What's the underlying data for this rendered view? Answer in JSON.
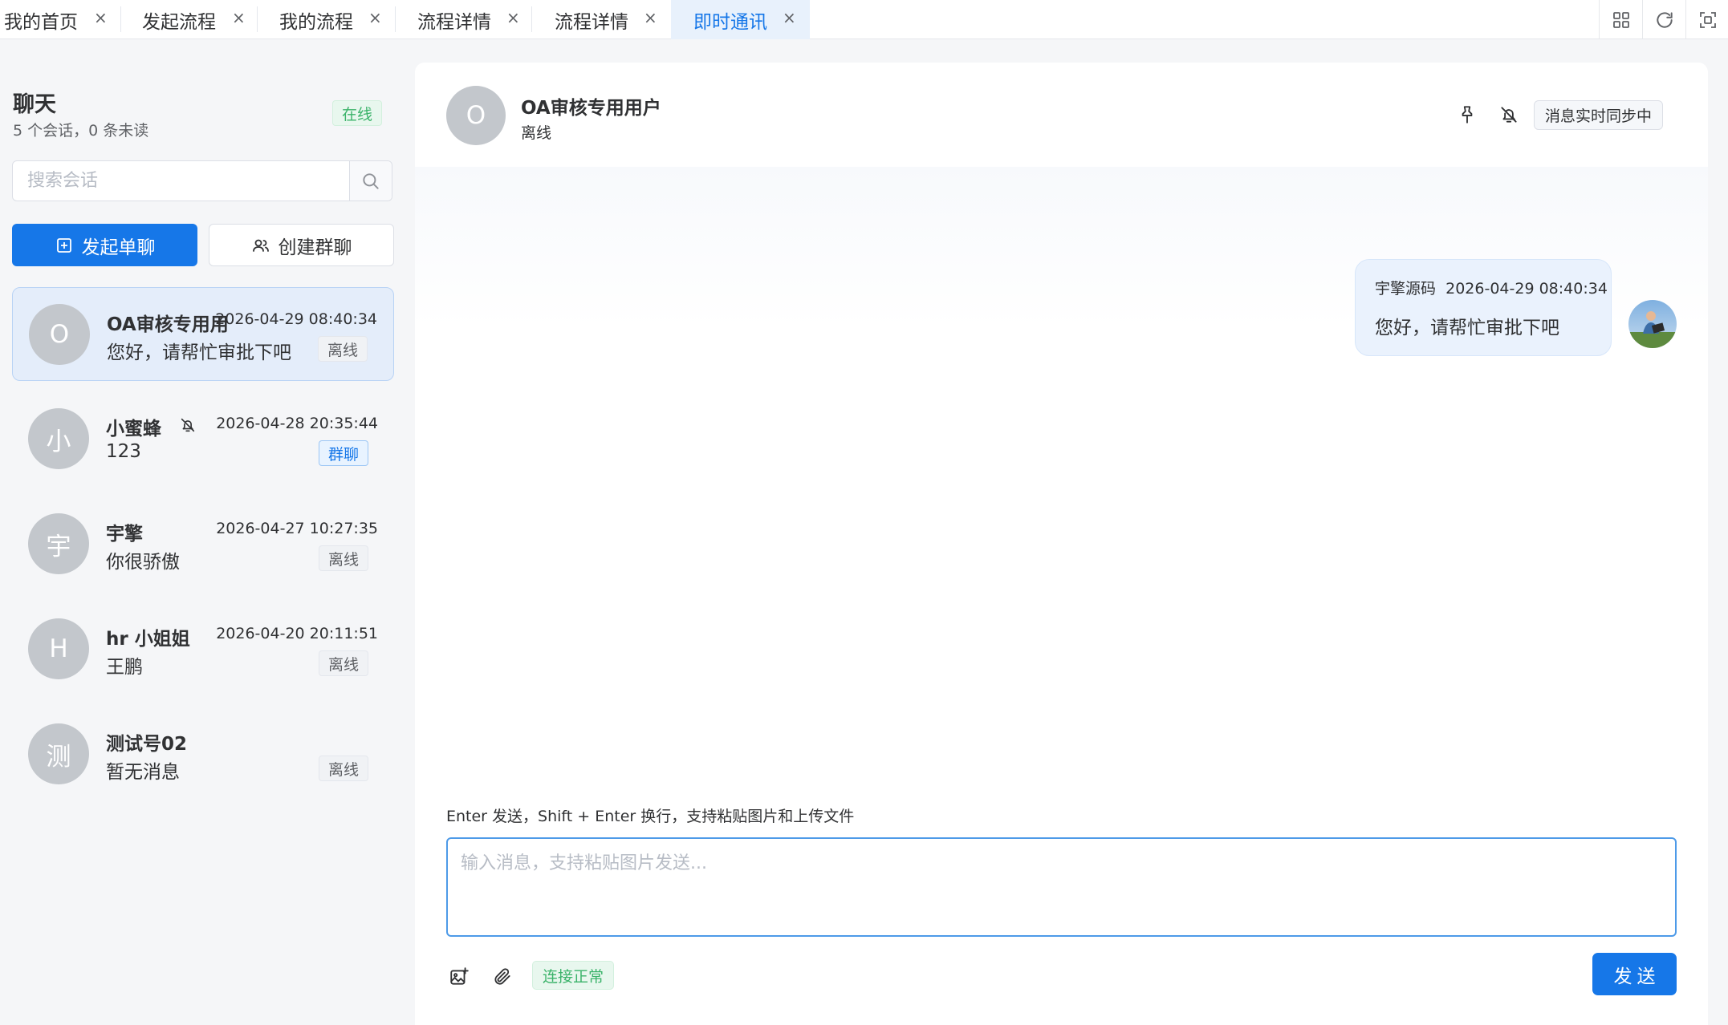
{
  "tabs": [
    {
      "label": "我的首页",
      "close": "×"
    },
    {
      "label": "发起流程",
      "close": "×"
    },
    {
      "label": "我的流程",
      "close": "×"
    },
    {
      "label": "流程详情",
      "close": "×"
    },
    {
      "label": "流程详情",
      "close": "×"
    },
    {
      "label": "即时通讯",
      "close": "×",
      "active": true
    }
  ],
  "toolbar": {
    "icons": [
      "grid-icon",
      "refresh-icon",
      "fullscreen-icon"
    ]
  },
  "sidebar": {
    "title": "聊天",
    "summary": "5 个会话，0 条未读",
    "status": "在线",
    "search": {
      "placeholder": "搜索会话",
      "value": ""
    },
    "new_single": "发起单聊",
    "new_group": "创建群聊",
    "conversations": [
      {
        "initial": "O",
        "name": "OA审核专用用户",
        "time": "2026-04-29 08:40:34",
        "preview": "您好，请帮忙审批下吧",
        "tag": "离线",
        "active": true
      },
      {
        "initial": "小",
        "name": "小蜜蜂",
        "time": "2026-04-28 20:35:44",
        "preview": "123",
        "tag": "群聊",
        "muted": true
      },
      {
        "initial": "宇",
        "name": "宇擎",
        "time": "2026-04-27 10:27:35",
        "preview": "你很骄傲",
        "tag": "离线"
      },
      {
        "initial": "H",
        "name": "hr 小姐姐",
        "time": "2026-04-20 20:11:51",
        "preview": "王鹏",
        "tag": "离线"
      },
      {
        "initial": "测",
        "name": "测试号02",
        "time": "",
        "preview": "暂无消息",
        "tag": "离线"
      }
    ]
  },
  "chat": {
    "peer": {
      "initial": "O",
      "name": "OA审核专用用户",
      "status": "离线"
    },
    "sync_status": "消息实时同步中",
    "messages": [
      {
        "sender": "宇擎源码",
        "time": "2026-04-29 08:40:34",
        "text": "您好，请帮忙审批下吧",
        "self": true
      }
    ],
    "hint": "Enter 发送，Shift + Enter 换行，支持粘贴图片和上传文件",
    "input": {
      "placeholder": "输入消息，支持粘贴图片发送...",
      "value": ""
    },
    "connection": "连接正常",
    "send_label": "发送"
  },
  "colors": {
    "primary": "#1677e8",
    "success": "#3bb36a",
    "active_bg": "#e4edfa"
  }
}
